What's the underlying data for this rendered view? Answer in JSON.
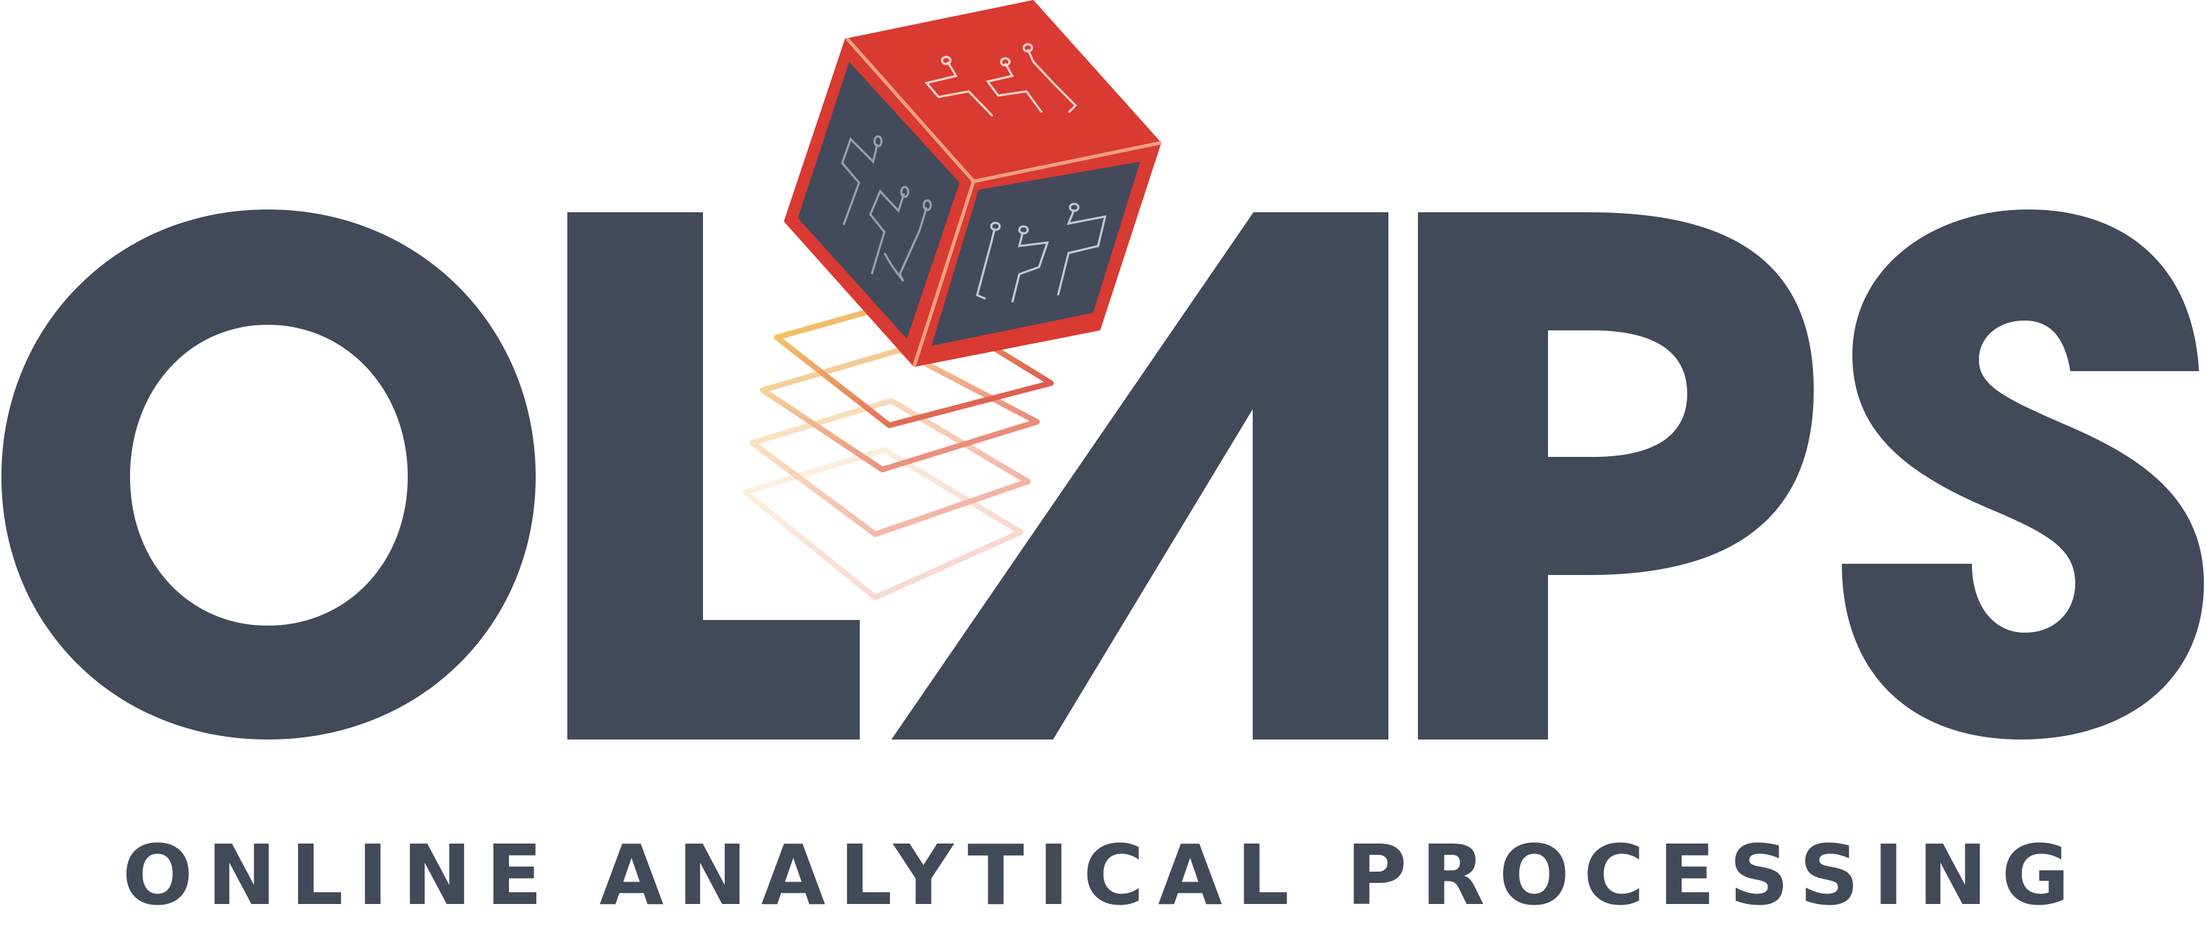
{
  "logo": {
    "wordmark": "OLAPS",
    "tagline": "ONLINE ANALYTICAL PROCESSING"
  },
  "icon": "data-cube-icon",
  "colors": {
    "ink": "#424959",
    "cube_red": "#d93a31",
    "cube_face": "#434a5c",
    "layer_1": "#d9434b",
    "layer_2": "#e5736f",
    "layer_3": "#efa59f",
    "layer_4": "#f6cfca",
    "layer_yellow": "#f7d870",
    "background": "#ffffff"
  }
}
